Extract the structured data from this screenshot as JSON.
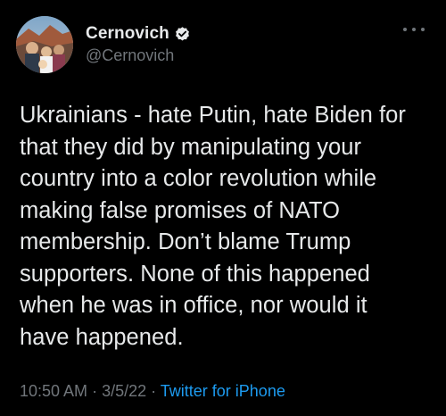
{
  "tweet": {
    "author": {
      "display_name": "Cernovich",
      "handle": "@Cernovich",
      "verified_icon": "verified-badge-icon"
    },
    "more_icon": "more-dots-icon",
    "text_lines": [
      "Ukrainians - hate Putin, hate Biden for",
      "that they did by manipulating your",
      "country into a color revolution while",
      "making false promises of NATO",
      "membership. Don’t blame Trump",
      "supporters. None of this happened",
      "when he was in office, nor would it",
      "have happened."
    ],
    "time": "10:50 AM",
    "separator": " · ",
    "date": "3/5/22",
    "source": "Twitter for iPhone"
  },
  "colors": {
    "background": "#000000",
    "text": "#e7e9ea",
    "muted": "#71767b",
    "link": "#1d9bf0"
  }
}
